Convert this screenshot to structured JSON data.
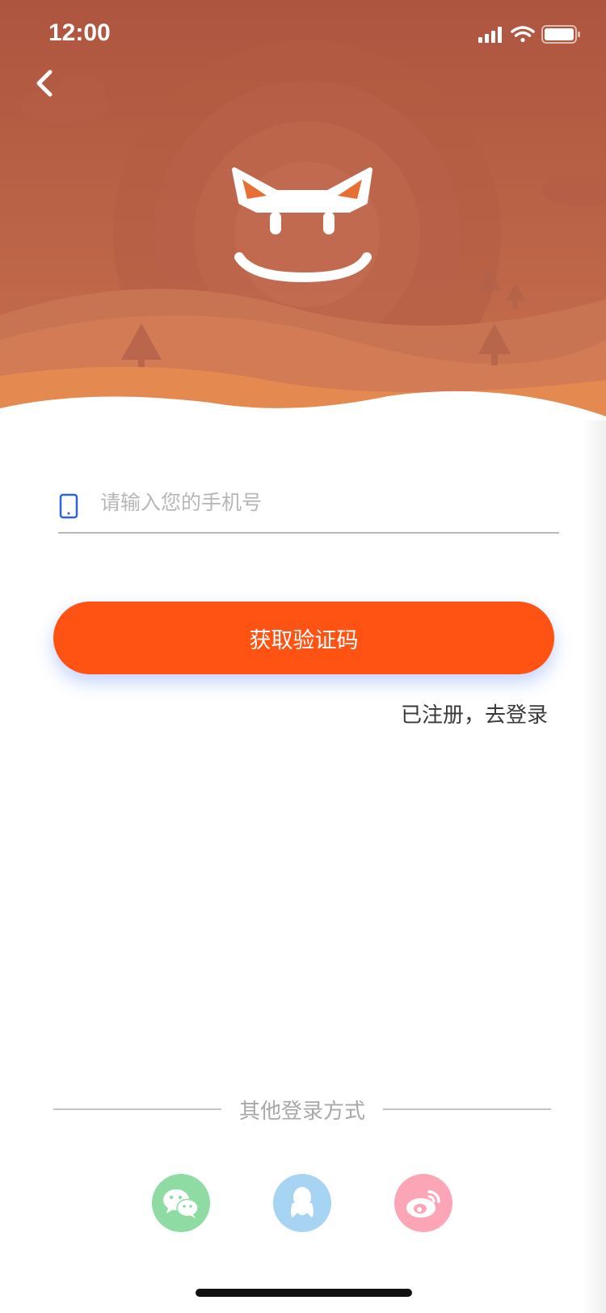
{
  "status_bar": {
    "time": "12:00"
  },
  "header": {
    "back_icon": "chevron-left-icon",
    "mascot_icon": "fox-face-logo"
  },
  "phone": {
    "placeholder": "请输入您的手机号",
    "value": "",
    "icon": "mobile-phone-icon"
  },
  "actions": {
    "get_code_label": "获取验证码",
    "login_link": "已注册，去登录"
  },
  "other_login": {
    "label": "其他登录方式",
    "providers": [
      {
        "id": "wechat",
        "icon": "wechat-icon",
        "color": "#8edca3"
      },
      {
        "id": "qq",
        "icon": "qq-icon",
        "color": "#a6d4f2"
      },
      {
        "id": "weibo",
        "icon": "weibo-icon",
        "color": "#fba5b7"
      }
    ]
  },
  "colors": {
    "accent": "#ff5313",
    "header_top": "#ae5640",
    "header_bottom": "#e9894f",
    "phone_icon": "#2d63d8"
  }
}
